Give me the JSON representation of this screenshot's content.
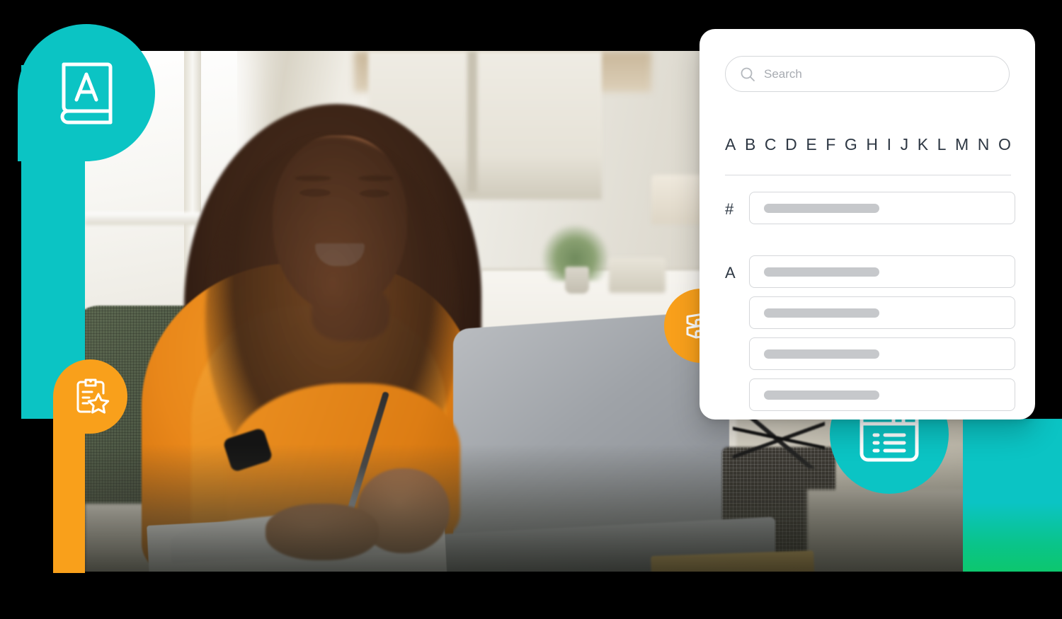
{
  "colors": {
    "teal": "#0BC4C4",
    "orange": "#F9A01B",
    "green": "#0CC76E",
    "text_dark": "#2D3743",
    "placeholder": "#A7ABB1",
    "border": "#D5D7DA",
    "skeleton": "#C6C8CB",
    "card_background": "#FFFFFF"
  },
  "card": {
    "search": {
      "value": "",
      "placeholder": "Search",
      "icon": "search-icon"
    },
    "alphabet": [
      "A",
      "B",
      "C",
      "D",
      "E",
      "F",
      "G",
      "H",
      "I",
      "J",
      "K",
      "L",
      "M",
      "N",
      "O"
    ],
    "groups": [
      {
        "label": "#",
        "rows": [
          {
            "skeleton_width": "46%"
          }
        ]
      },
      {
        "label": "A",
        "rows": [
          {
            "skeleton_width": "46%"
          },
          {
            "skeleton_width": "46%"
          },
          {
            "skeleton_width": "46%"
          },
          {
            "skeleton_width": "46%"
          }
        ]
      }
    ]
  },
  "badges": [
    {
      "id": "book",
      "icon": "book-a-icon",
      "color": "#0BC4C4",
      "shape": "pin"
    },
    {
      "id": "clipboard",
      "icon": "clipboard-star-icon",
      "color": "#F9A01B",
      "shape": "pin"
    },
    {
      "id": "layers",
      "icon": "layers-stack-icon",
      "color": "#F9A01B",
      "shape": "circle"
    },
    {
      "id": "window",
      "icon": "browser-list-icon",
      "color": "#0BC4C4",
      "shape": "circle"
    }
  ],
  "photo": {
    "alt": "Smiling woman writing in a notebook at a desk with a laptop"
  }
}
